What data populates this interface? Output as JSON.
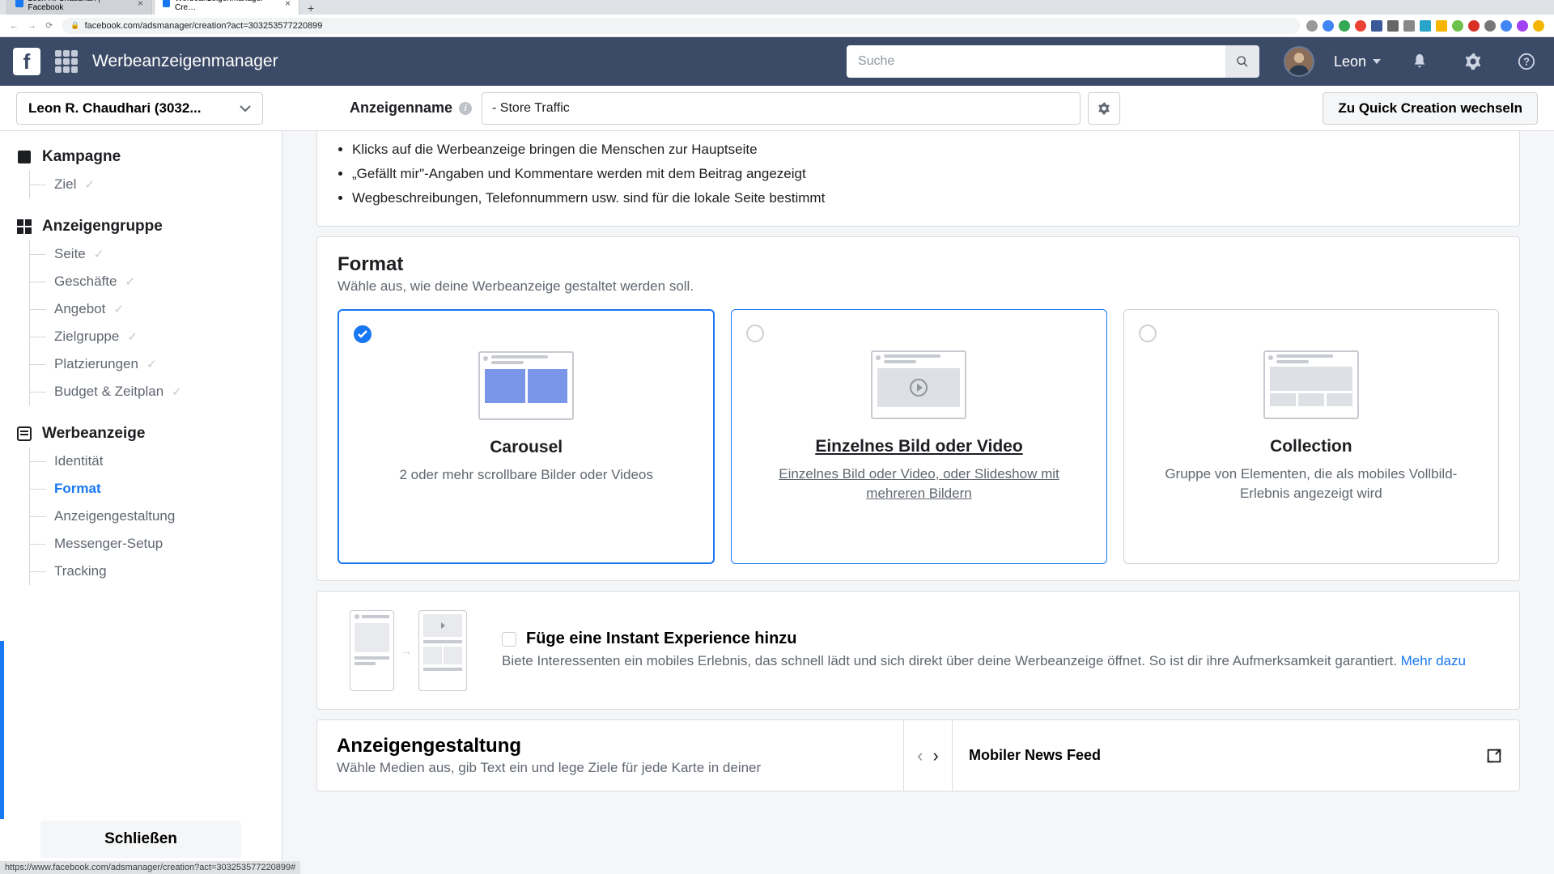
{
  "browser": {
    "tabs": [
      {
        "title": "Leon R. Chaudhari | Facebook"
      },
      {
        "title": "Werbeanzeigenmanager - Cre…"
      }
    ],
    "url": "facebook.com/adsmanager/creation?act=303253577220899"
  },
  "header": {
    "title": "Werbeanzeigenmanager",
    "search_placeholder": "Suche",
    "username": "Leon"
  },
  "secondary": {
    "account": "Leon R. Chaudhari (3032...",
    "ad_name_label": "Anzeigenname",
    "ad_name_value": "- Store Traffic",
    "quick_btn": "Zu Quick Creation wechseln"
  },
  "sidebar": {
    "campaign": {
      "label": "Kampagne",
      "items": [
        {
          "label": "Ziel",
          "checked": true
        }
      ]
    },
    "adset": {
      "label": "Anzeigengruppe",
      "items": [
        {
          "label": "Seite",
          "checked": true
        },
        {
          "label": "Geschäfte",
          "checked": true
        },
        {
          "label": "Angebot",
          "checked": true
        },
        {
          "label": "Zielgruppe",
          "checked": true
        },
        {
          "label": "Platzierungen",
          "checked": true
        },
        {
          "label": "Budget & Zeitplan",
          "checked": true
        }
      ]
    },
    "ad": {
      "label": "Werbeanzeige",
      "items": [
        {
          "label": "Identität"
        },
        {
          "label": "Format",
          "active": true
        },
        {
          "label": "Anzeigengestaltung"
        },
        {
          "label": "Messenger-Setup"
        },
        {
          "label": "Tracking"
        }
      ]
    },
    "close": "Schließen"
  },
  "content": {
    "info_bullets": [
      "Klicks auf die Werbeanzeige bringen die Menschen zur Hauptseite",
      "„Gefällt mir\"-Angaben und Kommentare werden mit dem Beitrag angezeigt",
      "Wegbeschreibungen, Telefonnummern usw. sind für die lokale Seite bestimmt"
    ],
    "format": {
      "title": "Format",
      "subtitle": "Wähle aus, wie deine Werbeanzeige gestaltet werden soll.",
      "options": [
        {
          "title": "Carousel",
          "desc": "2 oder mehr scrollbare Bilder oder Videos",
          "selected": true
        },
        {
          "title": "Einzelnes Bild oder Video",
          "desc": "Einzelnes Bild oder Video, oder Slideshow mit mehreren Bildern",
          "hover": true
        },
        {
          "title": "Collection",
          "desc": "Gruppe von Elementen, die als mobiles Vollbild-Erlebnis angezeigt wird"
        }
      ]
    },
    "instant": {
      "title": "Füge eine Instant Experience hinzu",
      "desc": "Biete Interessenten ein mobiles Erlebnis, das schnell lädt und sich direkt über deine Werbeanzeige öffnet. So ist dir ihre Aufmerksamkeit garantiert. ",
      "link": "Mehr dazu"
    },
    "gestaltung": {
      "title": "Anzeigengestaltung",
      "subtitle": "Wähle Medien aus, gib Text ein und lege Ziele für jede Karte in deiner",
      "preview_label": "Mobiler News Feed"
    }
  },
  "status_url": "https://www.facebook.com/adsmanager/creation?act=303253577220899#"
}
